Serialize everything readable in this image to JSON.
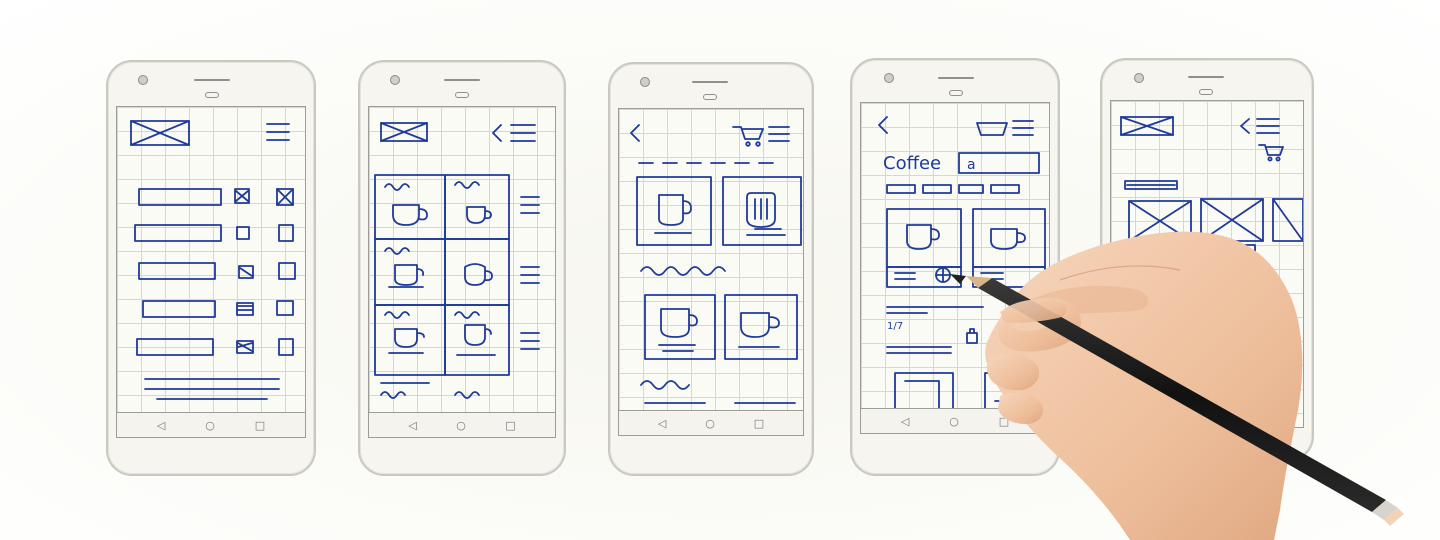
{
  "palette": {
    "ink": "#1e3a9a",
    "paper": "#f6f5ef",
    "grid": "#d7d6cf",
    "phone_border": "#c9c8c1",
    "skin": "#f0c7a6",
    "pencil": "#1b1b1b",
    "eraser": "#f3d3b8"
  },
  "phones": [
    {
      "id": "phone-1",
      "screen": "list",
      "nav_icons": [
        "back-triangle-icon",
        "home-circle-icon",
        "recents-square-icon"
      ]
    },
    {
      "id": "phone-2",
      "screen": "grid",
      "nav_icons": [
        "back-triangle-icon",
        "home-circle-icon",
        "recents-square-icon"
      ]
    },
    {
      "id": "phone-3",
      "screen": "product-grid",
      "nav_icons": [
        "back-triangle-icon",
        "home-circle-icon",
        "recents-square-icon"
      ]
    },
    {
      "id": "phone-4",
      "screen": "search",
      "search_label": "Coffee",
      "search_field_text": "a",
      "counter_text": "1/7",
      "nav_icons": [
        "back-triangle-icon",
        "home-circle-icon",
        "recents-square-icon"
      ]
    },
    {
      "id": "phone-5",
      "screen": "carousel",
      "nav_icons": []
    }
  ],
  "nav_glyphs": {
    "back": "◁",
    "home": "○",
    "recents": "□"
  }
}
